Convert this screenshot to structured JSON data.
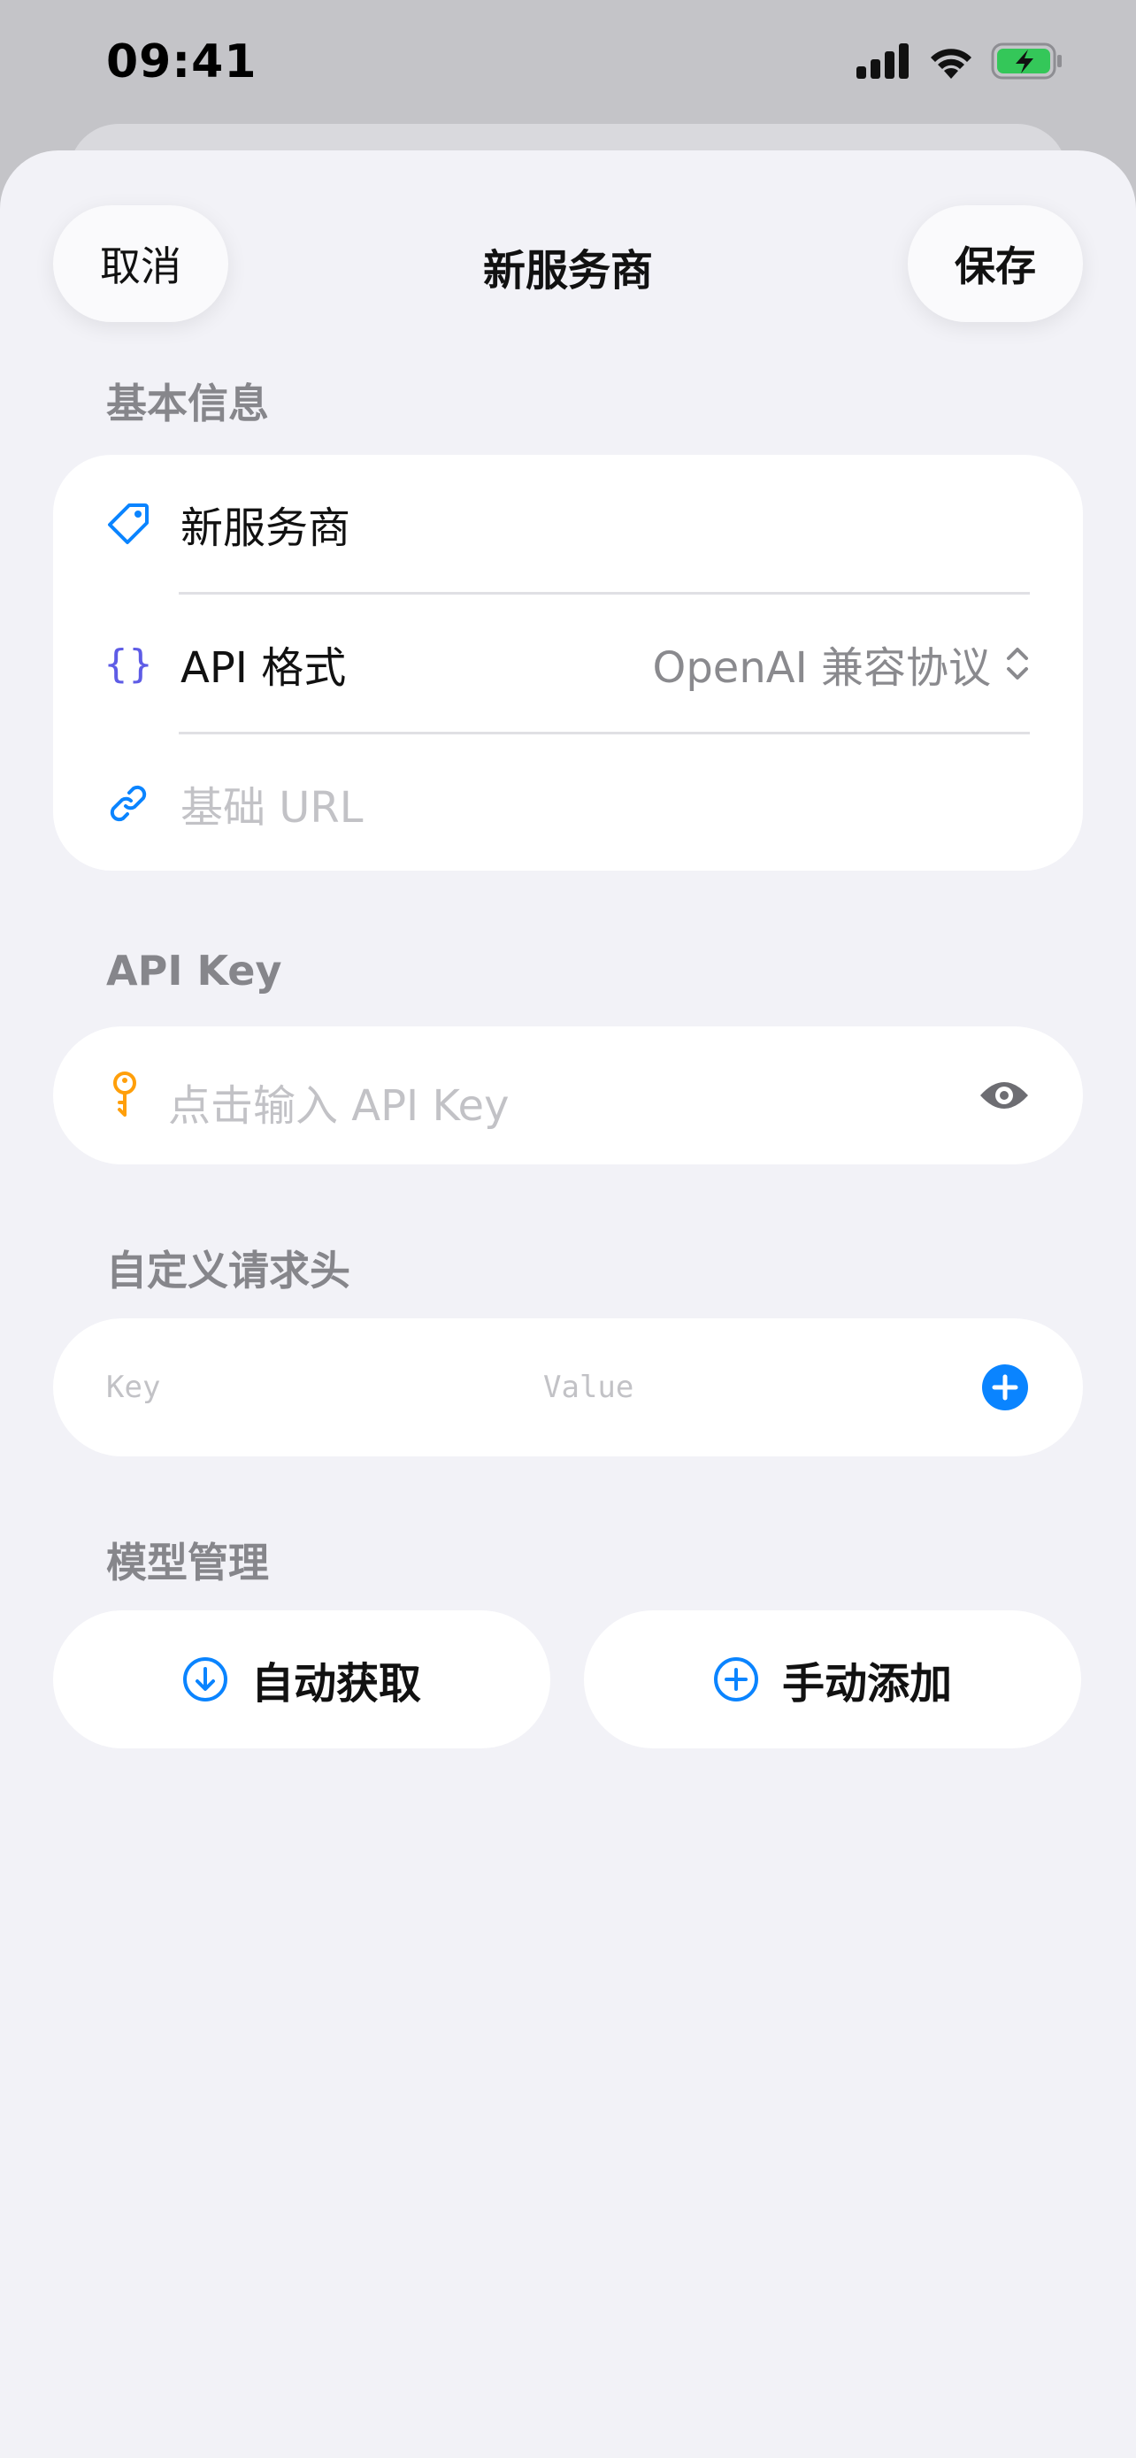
{
  "status_bar": {
    "time": "09:41"
  },
  "nav": {
    "cancel_label": "取消",
    "title": "新服务商",
    "save_label": "保存"
  },
  "basic_info": {
    "header": "基本信息",
    "name_value": "新服务商",
    "api_format_label": "API 格式",
    "api_format_value": "OpenAI 兼容协议",
    "base_url_placeholder": "基础 URL"
  },
  "api_key": {
    "header": "API Key",
    "placeholder": "点击输入 API Key"
  },
  "custom_headers": {
    "header": "自定义请求头",
    "key_placeholder": "Key",
    "value_placeholder": "Value"
  },
  "model_management": {
    "header": "模型管理",
    "auto_fetch_label": "自动获取",
    "manual_add_label": "手动添加"
  },
  "icons": {
    "tag": "tag-icon",
    "braces": "braces-icon",
    "link": "link-icon",
    "key": "key-icon",
    "eye": "eye-icon",
    "add": "plus-circle-icon",
    "download": "arrow-down-circle-icon",
    "up_down": "chevron-up-down-icon"
  },
  "colors": {
    "accent": "#0a84ff",
    "purple": "#5e5ce6",
    "orange": "#ff9f0a",
    "battery": "#34c759"
  }
}
